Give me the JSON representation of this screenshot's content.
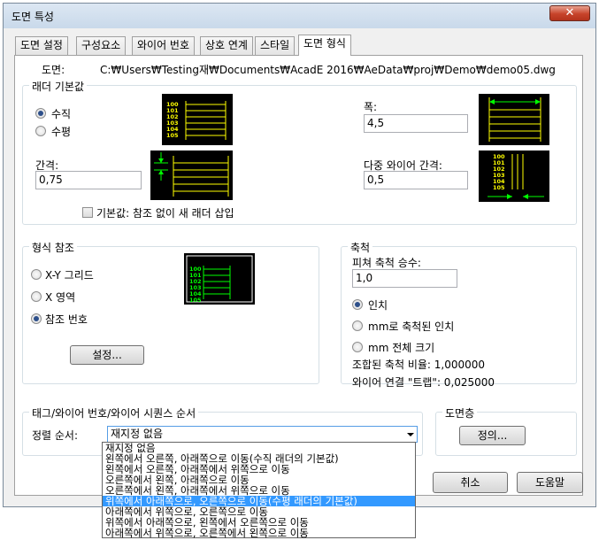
{
  "window": {
    "title": "도면 특성",
    "close_glyph": "✕"
  },
  "tabs": [
    {
      "label": "도면 설정"
    },
    {
      "label": "구성요소"
    },
    {
      "label": "와이어 번호"
    },
    {
      "label": "상호 연계"
    },
    {
      "label": "스타일"
    },
    {
      "label": "도면 형식"
    }
  ],
  "drawing": {
    "label": "도면:",
    "path": "C:₩Users₩Testing재₩Documents₩AcadE 2016₩AeData₩proj₩Demo₩demo05.dwg"
  },
  "ladder_defaults": {
    "title": "래더 기본값",
    "orientation_options": [
      {
        "label": "수직",
        "checked": true
      },
      {
        "label": "수평",
        "checked": false
      }
    ],
    "spacing_label": "간격:",
    "spacing_value": "0,75",
    "width_label": "폭:",
    "width_value": "4,5",
    "multiwire_label": "다중 와이어 간격:",
    "multiwire_value": "0,5",
    "default_checkbox_label": "기본값: 참조 없이 새 래더 삽입",
    "preview_numbers": [
      "100",
      "101",
      "102",
      "103",
      "104",
      "105"
    ],
    "preview_color": "#ffff00",
    "arrow_color": "#00ff00"
  },
  "format_ref": {
    "title": "형식 참조",
    "options": [
      {
        "label": "X-Y 그리드",
        "checked": false
      },
      {
        "label": "X 영역",
        "checked": false
      },
      {
        "label": "참조 번호",
        "checked": true
      }
    ],
    "setup_button": "설정...",
    "preview_numbers": [
      "100",
      "101",
      "102",
      "103",
      "104",
      "105"
    ],
    "preview_color": "#00ff00"
  },
  "scale": {
    "title": "축척",
    "feature_scale_label": "피쳐 축척 승수:",
    "feature_scale_value": "1,0",
    "options": [
      {
        "label": "인치",
        "checked": true
      },
      {
        "label": "mm로 축척된 인치",
        "checked": false
      },
      {
        "label": "mm 전체 크기",
        "checked": false
      }
    ],
    "combined_ratio": "조합된 축척 비율: 1,000000",
    "wire_gap": "와이어 연결 \"트랩\": 0,025000"
  },
  "sequence": {
    "title": "태그/와이어 번호/와이어 시퀀스 순서",
    "sort_label": "정렬 순서:",
    "selected_value": "재지정 없음",
    "options": [
      "재지정 없음",
      "왼쪽에서 오른쪽, 아래쪽으로 이동(수직 래더의 기본값)",
      "왼쪽에서 오른쪽, 아래쪽에서 위쪽으로 이동",
      "오른쪽에서 왼쪽, 아래쪽으로 이동",
      "오른쪽에서 왼쪽, 아래쪽에서 위쪽으로 이동",
      "위쪽에서 아래쪽으로, 오른쪽으로 이동(수평 래더의 기본값)",
      "아래쪽에서 위쪽으로, 오른쪽으로 이동",
      "위쪽에서 아래쪽으로, 왼쪽에서 오른쪽으로 이동",
      "아래쪽에서 위쪽으로, 오른쪽에서 왼쪽으로 이동"
    ],
    "highlighted_index": 5
  },
  "layers": {
    "title": "도면층",
    "define_button": "정의..."
  },
  "footer": {
    "cancel_button": "취소",
    "help_button": "도움말"
  }
}
